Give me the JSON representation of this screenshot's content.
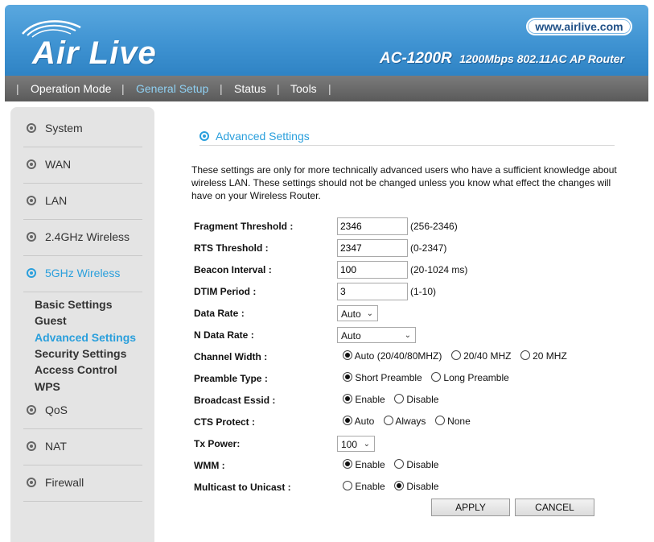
{
  "header": {
    "logo_text": "Air Live",
    "site": "www.airlive.com",
    "model_name": "AC-1200R",
    "model_desc": "1200Mbps 802.11AC AP Router"
  },
  "nav": {
    "items": [
      "Operation Mode",
      "General Setup",
      "Status",
      "Tools"
    ],
    "active": "General Setup"
  },
  "sidebar": {
    "items": [
      "System",
      "WAN",
      "LAN",
      "2.4GHz Wireless",
      "5GHz Wireless",
      "QoS",
      "NAT",
      "Firewall"
    ],
    "active": "5GHz Wireless",
    "subitems": [
      "Basic Settings",
      "Guest",
      "Advanced Settings",
      "Security Settings",
      "Access Control",
      "WPS"
    ],
    "active_sub": "Advanced Settings"
  },
  "main": {
    "title": "Advanced Settings",
    "description": "These settings are only for more technically advanced users who have a sufficient knowledge about wireless LAN. These settings should not be changed unless you know what effect the changes will have on your Wireless Router."
  },
  "form": {
    "fragment_threshold": {
      "label": "Fragment Threshold :",
      "value": "2346",
      "range": "(256-2346)"
    },
    "rts_threshold": {
      "label": "RTS Threshold :",
      "value": "2347",
      "range": "(0-2347)"
    },
    "beacon_interval": {
      "label": "Beacon Interval :",
      "value": "100",
      "range": "(20-1024 ms)"
    },
    "dtim_period": {
      "label": "DTIM Period :",
      "value": "3",
      "range": "(1-10)"
    },
    "data_rate": {
      "label": "Data Rate :",
      "value": "Auto"
    },
    "n_data_rate": {
      "label": "N Data Rate :",
      "value": "Auto"
    },
    "channel_width": {
      "label": "Channel Width :",
      "options": [
        "Auto (20/40/80MHZ)",
        "20/40 MHZ",
        "20 MHZ"
      ],
      "selected": "Auto (20/40/80MHZ)"
    },
    "preamble_type": {
      "label": "Preamble Type :",
      "options": [
        "Short Preamble",
        "Long Preamble"
      ],
      "selected": "Short Preamble"
    },
    "broadcast_essid": {
      "label": "Broadcast Essid :",
      "options": [
        "Enable",
        "Disable"
      ],
      "selected": "Enable"
    },
    "cts_protect": {
      "label": "CTS Protect :",
      "options": [
        "Auto",
        "Always",
        "None"
      ],
      "selected": "Auto"
    },
    "tx_power": {
      "label": "Tx Power:",
      "value": "100"
    },
    "wmm": {
      "label": "WMM :",
      "options": [
        "Enable",
        "Disable"
      ],
      "selected": "Enable"
    },
    "multicast_to_unicast": {
      "label": "Multicast to Unicast :",
      "options": [
        "Enable",
        "Disable"
      ],
      "selected": "Disable"
    }
  },
  "buttons": {
    "apply": "APPLY",
    "cancel": "CANCEL"
  },
  "colors": {
    "header_blue": "#3f93d2",
    "nav_gray": "#666666",
    "accent": "#2a9fdc",
    "sidebar_bg": "#e4e4e4"
  }
}
